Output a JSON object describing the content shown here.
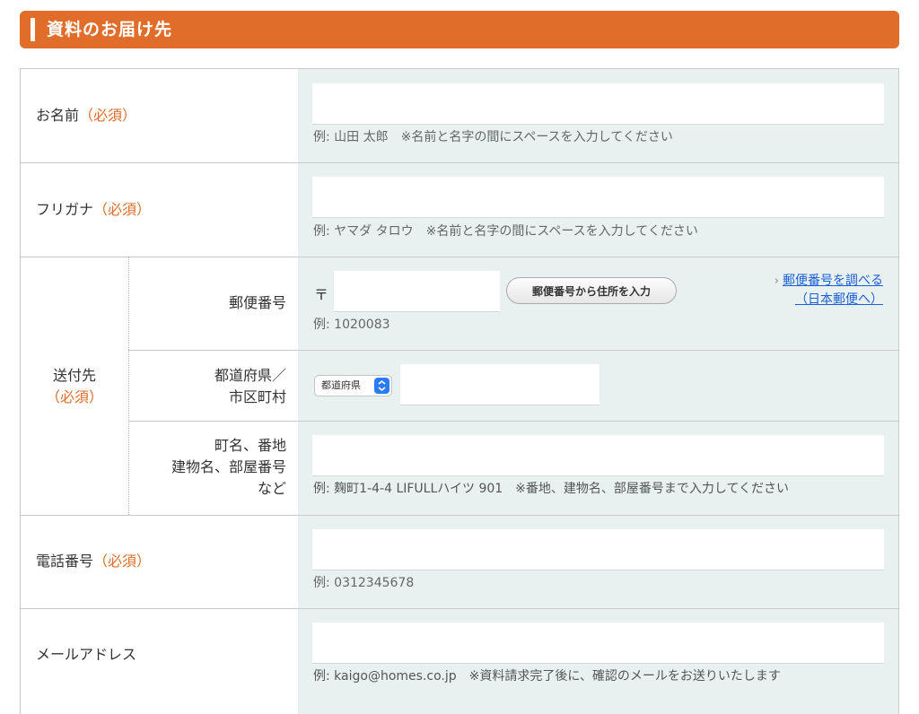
{
  "section": {
    "title": "資料のお届け先"
  },
  "colors": {
    "accent": "#e16d2a",
    "field_bg": "#e8f0f0",
    "link": "#1a5fd6"
  },
  "name_row": {
    "label": "お名前",
    "required": "（必須）",
    "value": "",
    "hint": "例: 山田 太郎　※名前と名字の間にスペースを入力してください"
  },
  "kana_row": {
    "label": "フリガナ",
    "required": "（必須）",
    "value": "",
    "hint": "例: ヤマダ タロウ　※名前と名字の間にスペースを入力してください"
  },
  "address_group": {
    "label": "送付先",
    "required": "（必須）",
    "postal": {
      "label": "郵便番号",
      "mark": "〒",
      "value": "",
      "button_label": "郵便番号から住所を入力",
      "lookup_link_line1": "郵便番号を調べる",
      "lookup_link_line2": "（日本郵便へ）",
      "hint": "例: 1020083"
    },
    "prefecture": {
      "label_line1": "都道府県／",
      "label_line2": "市区町村",
      "select_value": "都道府県",
      "city_value": ""
    },
    "street": {
      "label_line1": "町名、番地",
      "label_line2": "建物名、部屋番号",
      "label_line3": "など",
      "value": "",
      "hint": "例: 麹町1-4-4 LIFULLハイツ 901　※番地、建物名、部屋番号まで入力してください"
    }
  },
  "phone_row": {
    "label": "電話番号",
    "required": "（必須）",
    "value": "",
    "hint": "例: 0312345678"
  },
  "email_row": {
    "label": "メールアドレス",
    "value": "",
    "hint": "例: kaigo@homes.co.jp　※資料請求完了後に、確認のメールをお送りいたします"
  }
}
